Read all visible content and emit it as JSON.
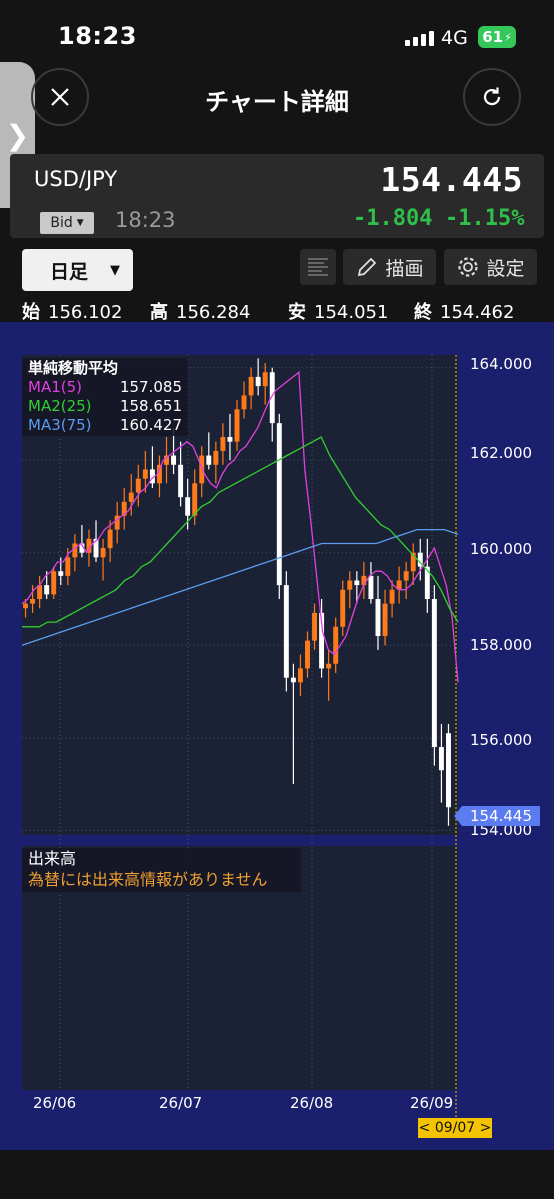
{
  "status_bar": {
    "time": "18:23",
    "network": "4G",
    "battery": "61"
  },
  "header": {
    "title": "チャート詳細",
    "close_icon": "close-icon",
    "refresh_icon": "refresh-icon"
  },
  "side_handle": {
    "label": "❯"
  },
  "quote": {
    "pair": "USD/JPY",
    "price": "154.445",
    "bid_label": "Bid",
    "time": "18:23",
    "change": "-1.804",
    "change_pct": "-1.15%"
  },
  "toolbar": {
    "period": "日足",
    "draw_label": "描画",
    "settings_label": "設定"
  },
  "ohlc": {
    "open_label": "始",
    "open": "156.102",
    "high_label": "高",
    "high": "156.284",
    "low_label": "安",
    "low": "154.051",
    "close_label": "終",
    "close": "154.462"
  },
  "indicator": {
    "title": "単純移動平均",
    "ma": [
      {
        "label": "MA1(5)",
        "value": "157.085",
        "color": "#e040e0"
      },
      {
        "label": "MA2(25)",
        "value": "158.651",
        "color": "#30d030"
      },
      {
        "label": "MA3(75)",
        "value": "160.427",
        "color": "#5a9cf0"
      }
    ]
  },
  "volume": {
    "title": "出来高",
    "message": "為替には出来高情報がありません"
  },
  "axes": {
    "y_labels": [
      "164.000",
      "162.000",
      "160.000",
      "158.000",
      "156.000",
      "154.000"
    ],
    "x_labels": [
      "26/06",
      "26/07",
      "26/08",
      "26/09"
    ],
    "current_price_tag": "154.445",
    "date_tag": "< 09/07 >"
  },
  "chart_data": {
    "type": "candlestick",
    "ylim": [
      153.9,
      164.1
    ],
    "x_ticks": [
      "26/06",
      "26/07",
      "26/08",
      "26/09"
    ],
    "y_ticks": [
      154,
      156,
      158,
      160,
      162,
      164
    ],
    "last_price": 154.445,
    "ma_series": {
      "MA1(5)": [
        158.9,
        159.0,
        159.2,
        159.3,
        159.5,
        159.6,
        159.8,
        159.8,
        160.0,
        160.1,
        160.2,
        160.0,
        160.2,
        160.3,
        160.5,
        160.6,
        160.7,
        160.8,
        160.9,
        161.1,
        161.3,
        161.4,
        161.6,
        161.7,
        162.0,
        162.1,
        162.2,
        162.3,
        162.4,
        162.3,
        162.0,
        161.7,
        161.5,
        161.4,
        161.7,
        161.9,
        162.0,
        162.2,
        162.3,
        162.5,
        162.7,
        163.0,
        163.3,
        163.5,
        163.6,
        163.7,
        163.8,
        163.9,
        161.8,
        160.7,
        159.5,
        158.3,
        157.9,
        157.8,
        158.0,
        158.2,
        158.6,
        159.0,
        159.3,
        159.5,
        159.6,
        159.6,
        159.5,
        159.3,
        159.2,
        159.2,
        159.3,
        159.5,
        159.7,
        159.9,
        160.1,
        159.7,
        159.3,
        158.6,
        157.2
      ],
      "MA2(25)": [
        158.4,
        158.4,
        158.4,
        158.5,
        158.5,
        158.6,
        158.7,
        158.8,
        158.9,
        159.0,
        159.1,
        159.2,
        159.4,
        159.5,
        159.7,
        159.8,
        160.0,
        160.2,
        160.4,
        160.6,
        160.8,
        161.0,
        161.1,
        161.3,
        161.4,
        161.5,
        161.6,
        161.7,
        161.8,
        161.9,
        162.0,
        162.1,
        162.2,
        162.3,
        162.4,
        162.5,
        162.1,
        161.8,
        161.5,
        161.2,
        161.0,
        160.8,
        160.6,
        160.5,
        160.3,
        160.1,
        159.9,
        159.7,
        159.5,
        159.2,
        158.8,
        158.5
      ],
      "MA3(75)": [
        158.0,
        158.1,
        158.2,
        158.3,
        158.4,
        158.5,
        158.6,
        158.7,
        158.8,
        158.9,
        159.0,
        159.1,
        159.2,
        159.3,
        159.4,
        159.5,
        159.6,
        159.7,
        159.8,
        159.9,
        160.0,
        160.1,
        160.2,
        160.2,
        160.2,
        160.2,
        160.2,
        160.3,
        160.4,
        160.5,
        160.5,
        160.5,
        160.4
      ]
    },
    "candles": [
      [
        158.8,
        159.0,
        158.6,
        158.9
      ],
      [
        158.9,
        159.3,
        158.7,
        159.0
      ],
      [
        159.0,
        159.5,
        158.8,
        159.3
      ],
      [
        159.3,
        159.6,
        159.0,
        159.1
      ],
      [
        159.1,
        159.7,
        159.0,
        159.6
      ],
      [
        159.6,
        159.9,
        159.3,
        159.5
      ],
      [
        159.5,
        160.1,
        159.3,
        159.9
      ],
      [
        159.9,
        160.4,
        159.6,
        160.2
      ],
      [
        160.2,
        160.6,
        159.9,
        160.0
      ],
      [
        160.0,
        160.5,
        159.7,
        160.3
      ],
      [
        160.3,
        160.7,
        159.8,
        159.9
      ],
      [
        159.9,
        160.3,
        159.4,
        160.1
      ],
      [
        160.1,
        160.7,
        159.8,
        160.5
      ],
      [
        160.5,
        161.1,
        160.2,
        160.8
      ],
      [
        160.8,
        161.4,
        160.5,
        161.1
      ],
      [
        161.1,
        161.7,
        160.8,
        161.3
      ],
      [
        161.3,
        161.9,
        161.0,
        161.6
      ],
      [
        161.6,
        162.2,
        161.3,
        161.8
      ],
      [
        161.8,
        162.3,
        161.4,
        161.5
      ],
      [
        161.5,
        162.1,
        161.2,
        161.9
      ],
      [
        161.9,
        162.5,
        161.5,
        162.1
      ],
      [
        162.1,
        162.7,
        161.7,
        161.9
      ],
      [
        161.9,
        162.4,
        161.0,
        161.2
      ],
      [
        161.2,
        161.6,
        160.5,
        160.8
      ],
      [
        160.8,
        161.8,
        160.6,
        161.5
      ],
      [
        161.5,
        162.3,
        161.2,
        162.1
      ],
      [
        162.1,
        162.6,
        161.8,
        161.9
      ],
      [
        161.9,
        162.4,
        161.5,
        162.2
      ],
      [
        162.2,
        162.8,
        161.9,
        162.5
      ],
      [
        162.5,
        163.0,
        162.0,
        162.4
      ],
      [
        162.4,
        163.3,
        162.2,
        163.1
      ],
      [
        163.1,
        163.7,
        162.9,
        163.4
      ],
      [
        163.4,
        164.0,
        163.1,
        163.8
      ],
      [
        163.8,
        164.2,
        163.4,
        163.6
      ],
      [
        163.6,
        164.1,
        163.2,
        163.9
      ],
      [
        163.9,
        164.0,
        162.4,
        162.8
      ],
      [
        162.8,
        163.0,
        159.0,
        159.3
      ],
      [
        159.3,
        159.6,
        157.0,
        157.3
      ],
      [
        157.3,
        157.6,
        155.0,
        157.2
      ],
      [
        157.2,
        157.8,
        156.9,
        157.5
      ],
      [
        157.5,
        158.3,
        157.3,
        158.1
      ],
      [
        158.1,
        158.9,
        157.9,
        158.7
      ],
      [
        158.7,
        159.0,
        157.3,
        157.5
      ],
      [
        157.5,
        157.9,
        156.8,
        157.6
      ],
      [
        157.6,
        158.6,
        157.4,
        158.4
      ],
      [
        158.4,
        159.4,
        158.2,
        159.2
      ],
      [
        159.2,
        159.6,
        158.8,
        159.4
      ],
      [
        159.4,
        159.6,
        158.9,
        159.3
      ],
      [
        159.3,
        159.8,
        159.0,
        159.5
      ],
      [
        159.5,
        159.8,
        158.9,
        159.0
      ],
      [
        159.0,
        159.5,
        157.9,
        158.2
      ],
      [
        158.2,
        159.2,
        158.0,
        158.9
      ],
      [
        158.9,
        159.4,
        158.6,
        159.2
      ],
      [
        159.2,
        159.7,
        158.9,
        159.4
      ],
      [
        159.4,
        159.8,
        159.0,
        159.6
      ],
      [
        159.6,
        160.2,
        159.3,
        160.0
      ],
      [
        160.0,
        160.3,
        159.4,
        159.7
      ],
      [
        159.7,
        160.3,
        158.7,
        159.0
      ],
      [
        159.0,
        159.3,
        155.4,
        155.8
      ],
      [
        155.8,
        156.3,
        154.6,
        155.3
      ],
      [
        156.1,
        156.3,
        154.1,
        154.5
      ]
    ]
  }
}
